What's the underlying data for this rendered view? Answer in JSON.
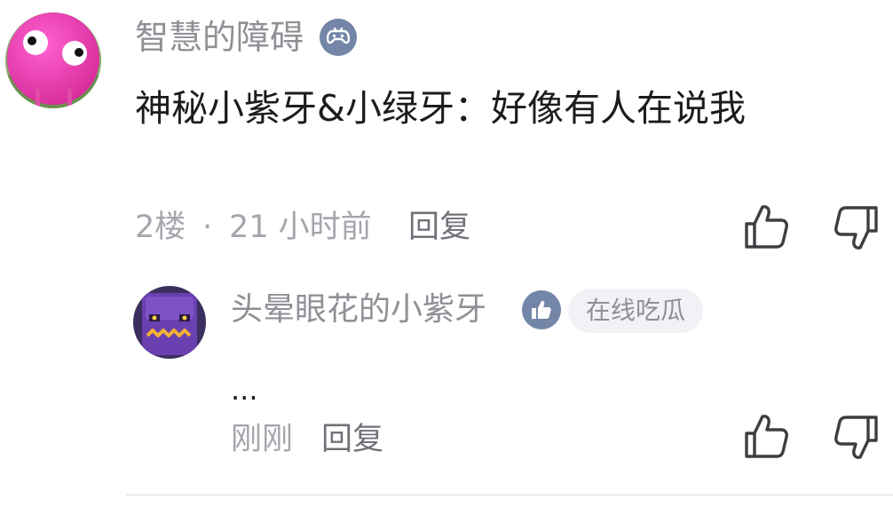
{
  "comment": {
    "username": "智慧的障碍",
    "badge_icon": "gamepad-icon",
    "text": "神秘小紫牙&小绿牙：好像有人在说我",
    "floor": "2楼",
    "separator": "·",
    "time": "21 小时前",
    "reply_label": "回复",
    "like_icon": "thumbs-up-icon",
    "dislike_icon": "thumbs-down-icon"
  },
  "reply": {
    "username": "头晕眼花的小紫牙",
    "badge_icon": "thumbs-up-icon",
    "tag": "在线吃瓜",
    "text": "...",
    "time": "刚刚",
    "reply_label": "回复",
    "like_icon": "thumbs-up-icon",
    "dislike_icon": "thumbs-down-icon"
  },
  "colors": {
    "badge": "#7386a8",
    "username": "#8f9096",
    "content": "#1c1c1e",
    "meta": "#a4a6ac"
  }
}
